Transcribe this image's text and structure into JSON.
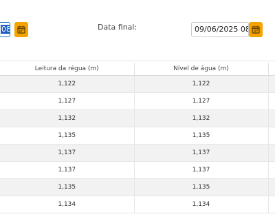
{
  "filters": {
    "start_date_visible_value": "08",
    "end_label": "Data final:",
    "end_date_value": "09/06/2025 08",
    "calendar_icon": "calendar-icon",
    "accent_color": "#f5a300"
  },
  "table": {
    "columns": [
      "Leitura da régua (m)",
      "Nível de água (m)",
      ""
    ],
    "rows": [
      {
        "leitura": "1,122",
        "nivel": "1,122"
      },
      {
        "leitura": "1,127",
        "nivel": "1,127"
      },
      {
        "leitura": "1,132",
        "nivel": "1,132"
      },
      {
        "leitura": "1,135",
        "nivel": "1,135"
      },
      {
        "leitura": "1,137",
        "nivel": "1,137"
      },
      {
        "leitura": "1,137",
        "nivel": "1,137"
      },
      {
        "leitura": "1,135",
        "nivel": "1,135"
      },
      {
        "leitura": "1,134",
        "nivel": "1,134"
      }
    ]
  }
}
